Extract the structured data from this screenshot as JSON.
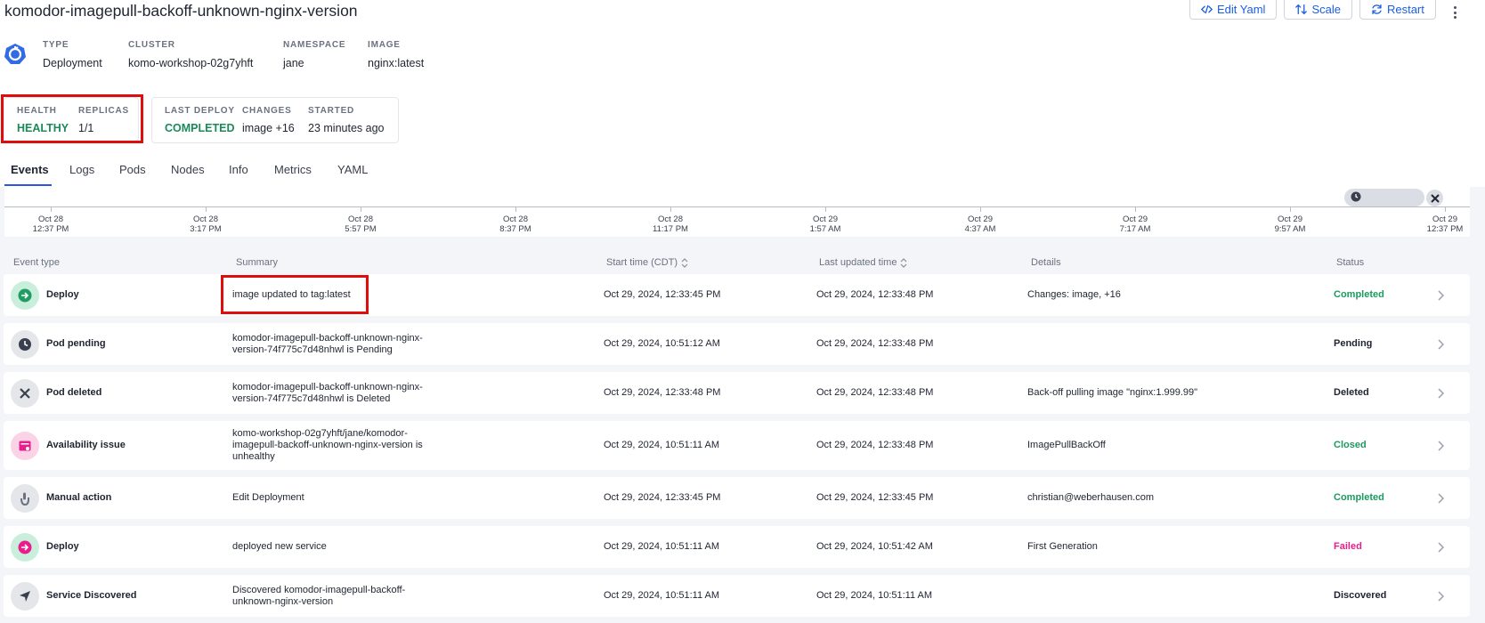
{
  "header": {
    "title": "komodor-imagepull-backoff-unknown-nginx-version",
    "actions": {
      "edit_yaml": "Edit Yaml",
      "scale": "Scale",
      "restart": "Restart"
    }
  },
  "meta": {
    "type_label": "TYPE",
    "type_value": "Deployment",
    "cluster_label": "CLUSTER",
    "cluster_value": "komo-workshop-02g7yhft",
    "namespace_label": "NAMESPACE",
    "namespace_value": "jane",
    "image_label": "IMAGE",
    "image_value": "nginx:latest"
  },
  "health_card": {
    "health_label": "HEALTH",
    "health_value": "HEALTHY",
    "replicas_label": "REPLICAS",
    "replicas_value": "1/1"
  },
  "deploy_card": {
    "last_deploy_label": "LAST DEPLOY",
    "last_deploy_value": "COMPLETED",
    "changes_label": "CHANGES",
    "changes_value": "image +16",
    "started_label": "STARTED",
    "started_value": "23 minutes ago"
  },
  "tabs": [
    {
      "label": "Events",
      "active": true
    },
    {
      "label": "Logs"
    },
    {
      "label": "Pods"
    },
    {
      "label": "Nodes"
    },
    {
      "label": "Info"
    },
    {
      "label": "Metrics"
    },
    {
      "label": "YAML"
    }
  ],
  "timeline": {
    "ticks": [
      {
        "date": "Oct 28",
        "time": "12:37 PM"
      },
      {
        "date": "Oct 28",
        "time": "3:17 PM"
      },
      {
        "date": "Oct 28",
        "time": "5:57 PM"
      },
      {
        "date": "Oct 28",
        "time": "8:37 PM"
      },
      {
        "date": "Oct 28",
        "time": "11:17 PM"
      },
      {
        "date": "Oct 29",
        "time": "1:57 AM"
      },
      {
        "date": "Oct 29",
        "time": "4:37 AM"
      },
      {
        "date": "Oct 29",
        "time": "7:17 AM"
      },
      {
        "date": "Oct 29",
        "time": "9:57 AM"
      },
      {
        "date": "Oct 29",
        "time": "12:37 PM"
      }
    ]
  },
  "table": {
    "headers": {
      "event_type": "Event type",
      "summary": "Summary",
      "start_time": "Start time (CDT)",
      "last_updated": "Last updated time",
      "details": "Details",
      "status": "Status"
    },
    "rows": [
      {
        "event": "Deploy",
        "icon": "deploy-icon",
        "summary": "image updated to tag:latest",
        "start": "Oct 29, 2024, 12:33:45 PM",
        "updated": "Oct 29, 2024, 12:33:48 PM",
        "details": "Changes: image, +16",
        "status": "Completed"
      },
      {
        "event": "Pod pending",
        "icon": "clock-icon",
        "summary": "komodor-imagepull-backoff-unknown-nginx-version-74f775c7d48nhwl is Pending",
        "start": "Oct 29, 2024, 10:51:12 AM",
        "updated": "Oct 29, 2024, 12:33:48 PM",
        "details": "",
        "status": "Pending"
      },
      {
        "event": "Pod deleted",
        "icon": "close-icon",
        "summary": "komodor-imagepull-backoff-unknown-nginx-version-74f775c7d48nhwl is Deleted",
        "start": "Oct 29, 2024, 12:33:48 PM",
        "updated": "Oct 29, 2024, 12:33:48 PM",
        "details": "Back-off pulling image \"nginx:1.999.99\"",
        "status": "Deleted"
      },
      {
        "event": "Availability issue",
        "icon": "availability-icon",
        "summary": "komo-workshop-02g7yhft/jane/komodor-imagepull-backoff-unknown-nginx-version is unhealthy",
        "start": "Oct 29, 2024, 10:51:11 AM",
        "updated": "Oct 29, 2024, 12:33:48 PM",
        "details": "ImagePullBackOff",
        "status": "Closed"
      },
      {
        "event": "Manual action",
        "icon": "hand-icon",
        "summary": "Edit Deployment",
        "start": "Oct 29, 2024, 12:33:45 PM",
        "updated": "Oct 29, 2024, 12:33:45 PM",
        "details": "christian@weberhausen.com",
        "status": "Completed"
      },
      {
        "event": "Deploy",
        "icon": "deploy-icon",
        "summary": "deployed new service",
        "start": "Oct 29, 2024, 10:51:11 AM",
        "updated": "Oct 29, 2024, 10:51:42 AM",
        "details": "First Generation",
        "status": "Failed"
      },
      {
        "event": "Service Discovered",
        "icon": "cursor-icon",
        "summary": "Discovered komodor-imagepull-backoff-unknown-nginx-version",
        "start": "Oct 29, 2024, 10:51:11 AM",
        "updated": "Oct 29, 2024, 10:51:11 AM",
        "details": "",
        "status": "Discovered"
      }
    ]
  },
  "colors": {
    "accent": "#1b5ee0",
    "healthy": "#1b8a5a",
    "completed": "#1b9a5f",
    "failed": "#e81e8c",
    "highlight": "#e00d0d"
  }
}
